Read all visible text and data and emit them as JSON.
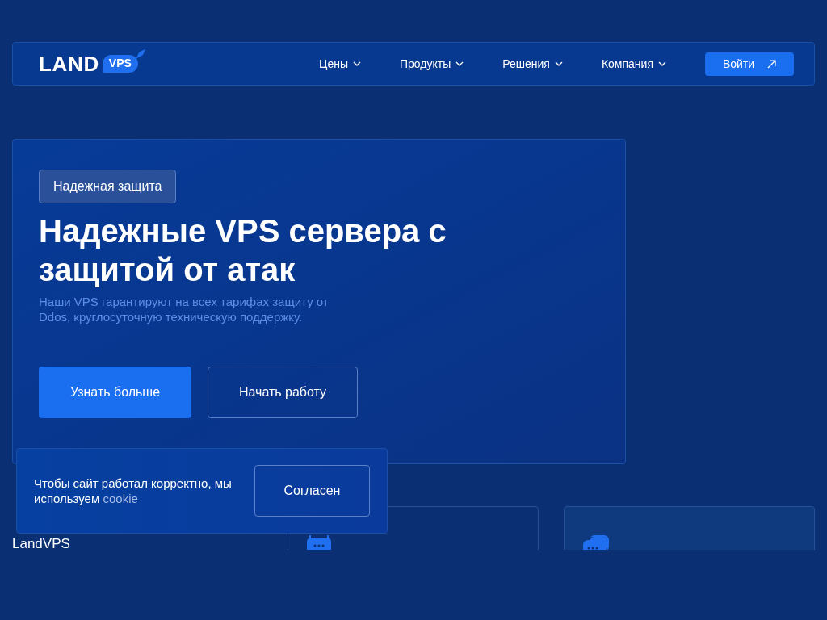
{
  "header": {
    "logo": {
      "word": "LAND",
      "badge": "VPS"
    },
    "nav": [
      {
        "label": "Цены"
      },
      {
        "label": "Продукты"
      },
      {
        "label": "Решения"
      },
      {
        "label": "Компания"
      }
    ],
    "login": "Войти"
  },
  "hero": {
    "tag": "Надежная защита",
    "title": "Надежные VPS сервера с защитой от атак",
    "text": "Наши VPS гарантируют на всех тарифах защиту от Ddos, круглосуточную техническую поддержку.",
    "primary": "Узнать больше",
    "secondary": "Начать работу"
  },
  "features": {
    "caption": "LandVPS",
    "cards": [
      {
        "kind": "support"
      },
      {
        "kind": "chat"
      }
    ]
  },
  "cookie": {
    "text": "Чтобы сайт работал корректно, мы используем",
    "link": "cookie",
    "button": "Согласен"
  }
}
